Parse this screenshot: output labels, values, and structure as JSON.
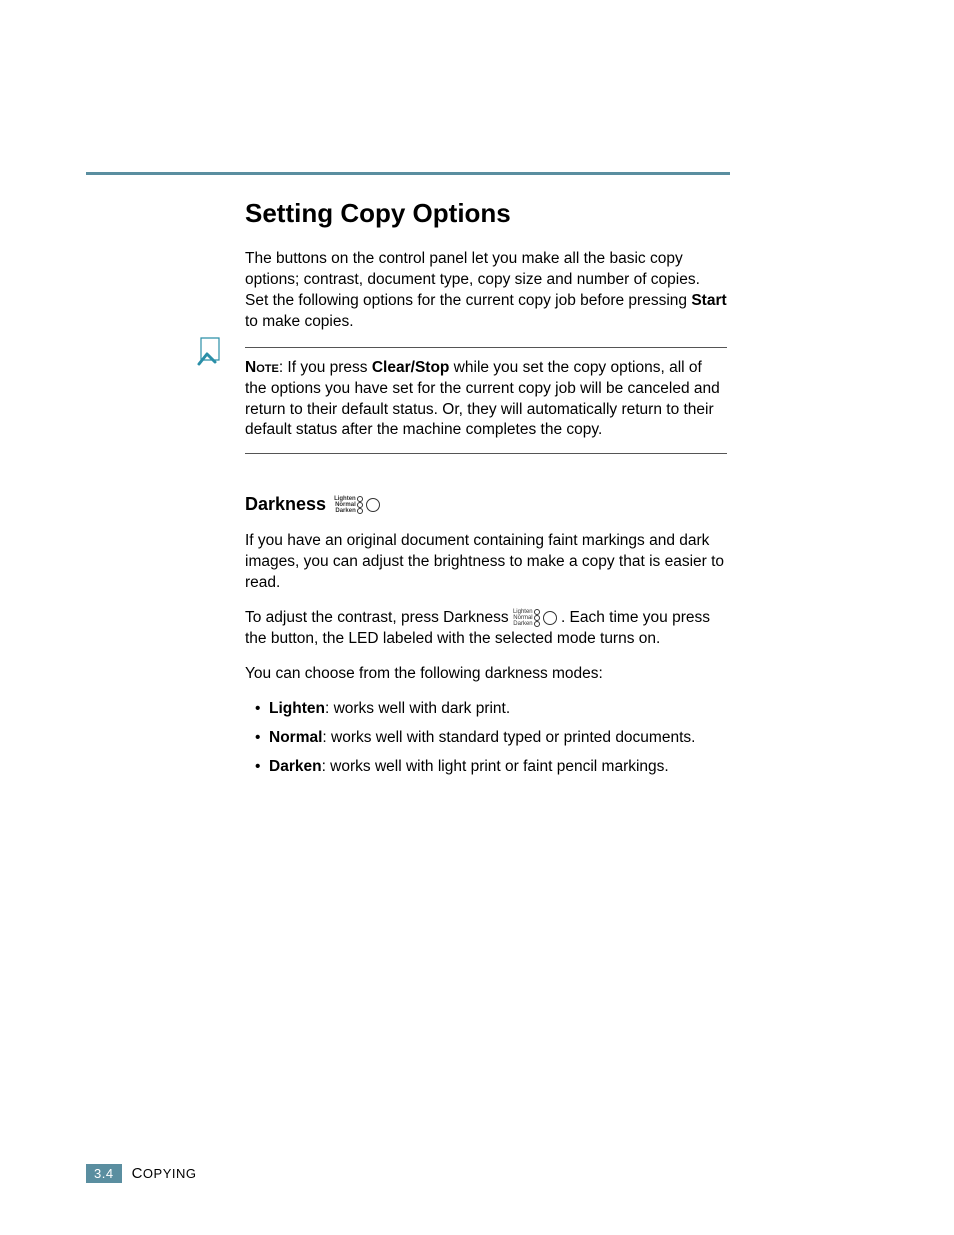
{
  "heading": "Setting Copy Options",
  "intro": {
    "pre": "The buttons on the control panel let you make all the basic copy options; contrast, document type, copy size and number of copies. Set the following options for the current copy job before pressing ",
    "bold": "Start",
    "post": " to make copies."
  },
  "note": {
    "label": "Note",
    "pre": ": If you press ",
    "bold": "Clear/Stop",
    "post": " while you set the copy options, all of the options you have set for the current copy job will be canceled and return to their default status. Or, they will automatically return to their default status after the machine completes the copy."
  },
  "darkness": {
    "heading": "Darkness",
    "icon_labels": {
      "l1": "Lighten",
      "l2": "Normal",
      "l3": "Darken"
    },
    "p1": "If you have an original document containing faint markings and dark images, you can adjust the brightness to make a copy that is easier to read.",
    "p2_pre": "To adjust the contrast, press  Darkness ",
    "p2_post": " .  Each time you press the button, the LED labeled with the selected mode turns on.",
    "p3": "You can choose from the following darkness modes:",
    "modes": [
      {
        "name": "Lighten",
        "desc": ": works well with dark print."
      },
      {
        "name": "Normal",
        "desc": ": works well with standard typed or printed documents."
      },
      {
        "name": "Darken",
        "desc": ": works well with light print or faint pencil markings."
      }
    ]
  },
  "footer": {
    "page": "3.4",
    "section_first": "C",
    "section_rest": "OPYING"
  }
}
